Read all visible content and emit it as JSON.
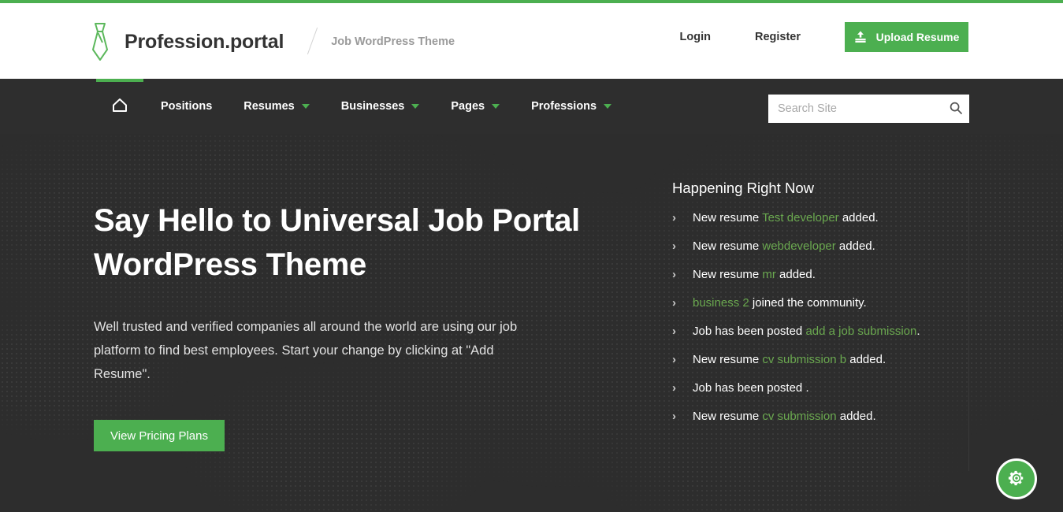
{
  "theme": {
    "accent_green": "#4caf50",
    "link_green": "#6aa84f",
    "dark_bg": "#2e2e2e",
    "header_bg": "#ffffff"
  },
  "header": {
    "brand_name": "Profession.portal",
    "tagline": "Job WordPress Theme",
    "logo_icon": "necktie-icon",
    "login_label": "Login",
    "register_label": "Register",
    "upload_label": "Upload Resume",
    "upload_icon": "upload-icon"
  },
  "nav": {
    "home_icon": "home-icon",
    "items": [
      {
        "label": "Positions",
        "has_caret": false
      },
      {
        "label": "Resumes",
        "has_caret": true
      },
      {
        "label": "Businesses",
        "has_caret": true
      },
      {
        "label": "Pages",
        "has_caret": true
      },
      {
        "label": "Professions",
        "has_caret": true
      }
    ],
    "search": {
      "placeholder": "Search Site",
      "value": "",
      "icon": "search-icon"
    }
  },
  "hero": {
    "title": "Say Hello to Universal Job Portal WordPress Theme",
    "subtitle": "Well trusted and verified companies all around the world are using our job platform to find best employees. Start your change by clicking at \"Add Resume\".",
    "cta_label": "View Pricing Plans"
  },
  "panel": {
    "title": "Happening Right Now",
    "bullet_icon": "chevron-right-icon",
    "items": [
      {
        "before": "New resume ",
        "link": "Test developer",
        "after": " added."
      },
      {
        "before": "New resume ",
        "link": "webdeveloper",
        "after": " added."
      },
      {
        "before": "New resume ",
        "link": "mr",
        "after": " added."
      },
      {
        "before": "",
        "link": "business 2",
        "after": " joined the community."
      },
      {
        "before": "Job has been posted ",
        "link": "add a job submission",
        "after": "."
      },
      {
        "before": "New resume ",
        "link": "cv submission b",
        "after": " added."
      },
      {
        "before": "Job has been posted .",
        "link": "",
        "after": ""
      },
      {
        "before": "New resume ",
        "link": "cv submission",
        "after": " added."
      }
    ]
  },
  "fab": {
    "icon": "gear-icon",
    "label": "Settings"
  }
}
